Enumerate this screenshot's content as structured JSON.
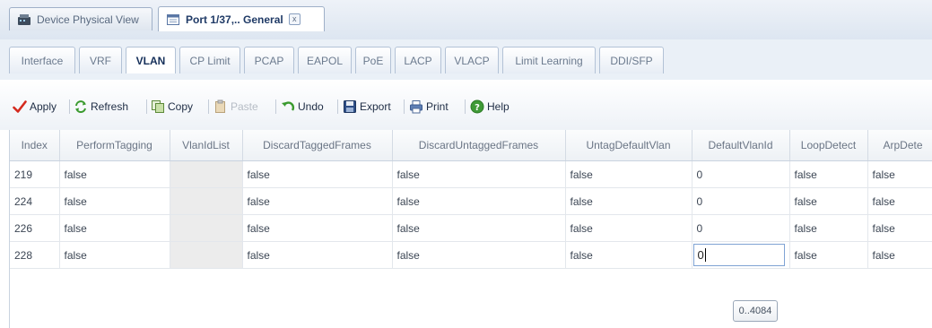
{
  "doc_tabs": [
    {
      "label": "Device Physical View",
      "icon": "device-icon",
      "active": false
    },
    {
      "label": "Port 1/37,.. General",
      "icon": "window-icon",
      "active": true,
      "close": "x"
    }
  ],
  "sub_tabs": [
    {
      "label": "Interface",
      "active": false
    },
    {
      "label": "VRF",
      "active": false
    },
    {
      "label": "VLAN",
      "active": true
    },
    {
      "label": "CP Limit",
      "active": false
    },
    {
      "label": "PCAP",
      "active": false
    },
    {
      "label": "EAPOL",
      "active": false
    },
    {
      "label": "PoE",
      "active": false
    },
    {
      "label": "LACP",
      "active": false
    },
    {
      "label": "VLACP",
      "active": false
    },
    {
      "label": "Limit Learning",
      "active": false
    },
    {
      "label": "DDI/SFP",
      "active": false
    }
  ],
  "toolbar": {
    "apply": "Apply",
    "refresh": "Refresh",
    "copy": "Copy",
    "paste": "Paste",
    "undo": "Undo",
    "export": "Export",
    "print": "Print",
    "help": "Help"
  },
  "grid": {
    "columns": [
      "Index",
      "PerformTagging",
      "VlanIdList",
      "DiscardTaggedFrames",
      "DiscardUntaggedFrames",
      "UntagDefaultVlan",
      "DefaultVlanId",
      "LoopDetect",
      "ArpDete"
    ],
    "rows": [
      [
        "219",
        "false",
        "",
        "false",
        "false",
        "false",
        "0",
        "false",
        "false"
      ],
      [
        "224",
        "false",
        "",
        "false",
        "false",
        "false",
        "0",
        "false",
        "false"
      ],
      [
        "226",
        "false",
        "",
        "false",
        "false",
        "false",
        "0",
        "false",
        "false"
      ],
      [
        "228",
        "false",
        "",
        "false",
        "false",
        "false",
        "0",
        "false",
        "false"
      ]
    ],
    "editing": {
      "row": 3,
      "column": 6,
      "value": "0"
    },
    "range_tip": "0..4084"
  },
  "colors": {
    "accent": "#1f3a66",
    "apply_check": "#d42a1e",
    "header_bg": "#edf1f5"
  }
}
